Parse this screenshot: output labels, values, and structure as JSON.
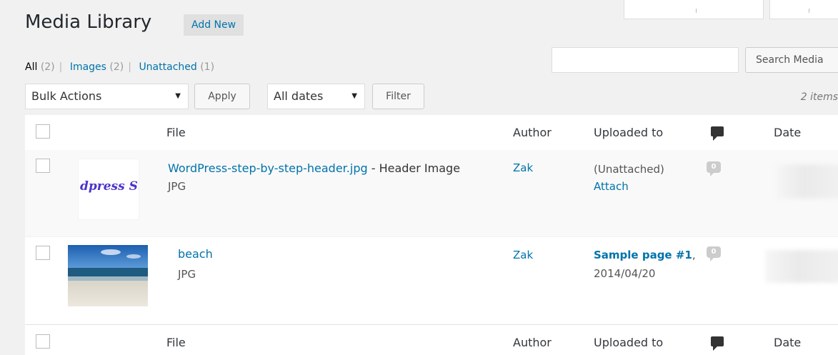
{
  "page": {
    "title": "Media Library",
    "add_new": "Add New"
  },
  "filters": {
    "all_label": "All",
    "all_count": "(2)",
    "images_label": "Images",
    "images_count": "(2)",
    "unattached_label": "Unattached",
    "unattached_count": "(1)"
  },
  "search": {
    "value": "",
    "button": "Search Media"
  },
  "bulk": {
    "selected": "Bulk Actions",
    "apply": "Apply",
    "dates_selected": "All dates",
    "filter": "Filter",
    "items_count": "2 items"
  },
  "columns": {
    "file": "File",
    "author": "Author",
    "uploaded_to": "Uploaded to",
    "comments_icon": "comment-icon",
    "date": "Date"
  },
  "rows": [
    {
      "thumb_text": "dpress St",
      "file_name": "WordPress-step-by-step-header.jpg",
      "title_suffix": " - Header Image",
      "type": "JPG",
      "author": "Zak",
      "uploaded_status": "(Unattached)",
      "attach_link": "Attach",
      "comments": "0"
    },
    {
      "file_name": "beach",
      "type": "JPG",
      "author": "Zak",
      "uploaded_to": "Sample page #1",
      "uploaded_date": "2014/04/20",
      "comments": "0"
    }
  ],
  "colors": {
    "link": "#0073aa",
    "background": "#f1f1f1",
    "header_text": "#23282d"
  }
}
